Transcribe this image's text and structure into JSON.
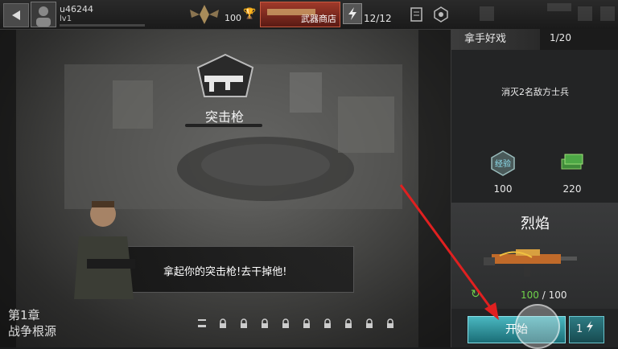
{
  "player": {
    "name": "u46244",
    "level": "lv1"
  },
  "topbar": {
    "rank_value": "100",
    "shop_label": "武器商店",
    "energy": "12/12"
  },
  "weapon_category": {
    "label": "突击枪"
  },
  "dialog": {
    "text": "拿起你的突击枪!去干掉他!"
  },
  "chapter": {
    "number": "第1章",
    "name": "战争根源"
  },
  "mission": {
    "title": "拿手好戏",
    "progress": "1/20",
    "objective": "消灭2名敌方士兵"
  },
  "rewards": [
    {
      "label": "经验",
      "value": "100"
    },
    {
      "label": "",
      "value": "220"
    }
  ],
  "equipped_weapon": {
    "name": "烈焰",
    "ammo_current": "100",
    "ammo_separator": "/",
    "ammo_max": "100"
  },
  "start_button": {
    "label": "开始",
    "cost": "1"
  },
  "colors": {
    "accent": "#4ab7c0",
    "ammo_green": "#6fd24a",
    "shop_red": "#a03a2a",
    "arrow_red": "#e02020"
  },
  "icons": [
    "back-arrow-icon",
    "avatar-icon",
    "rank-wings-icon",
    "trophy-icon",
    "lightning-icon",
    "task-list-icon",
    "settings-icon",
    "lock-icon",
    "experience-icon",
    "cash-icon",
    "refresh-icon"
  ]
}
